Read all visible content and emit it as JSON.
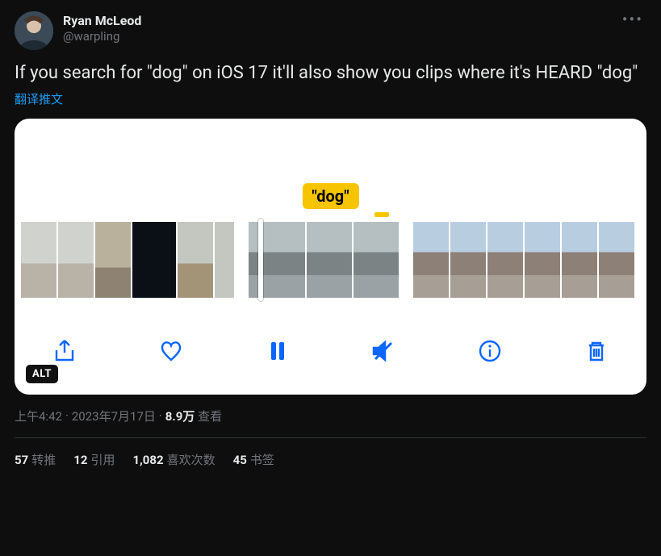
{
  "user": {
    "display_name": "Ryan McLeod",
    "handle": "@warpling"
  },
  "tweet_text": "If you search for \"dog\" on iOS 17 it'll also show you clips where it's HEARD \"dog\"",
  "translate_label": "翻译推文",
  "media": {
    "search_tag": "\"dog\"",
    "alt_badge": "ALT",
    "icons": {
      "share": "share-icon",
      "heart": "heart-icon",
      "pause": "pause-icon",
      "mute": "mute-icon",
      "info": "info-icon",
      "trash": "trash-icon"
    }
  },
  "meta": {
    "time": "上午4:42",
    "sep": " · ",
    "date": "2023年7月17日",
    "views_count": "8.9万",
    "views_label": " 查看"
  },
  "stats": {
    "retweets": {
      "count": "57",
      "label": "转推"
    },
    "quotes": {
      "count": "12",
      "label": "引用"
    },
    "likes": {
      "count": "1,082",
      "label": "喜欢次数"
    },
    "bookmarks": {
      "count": "45",
      "label": "书签"
    }
  }
}
